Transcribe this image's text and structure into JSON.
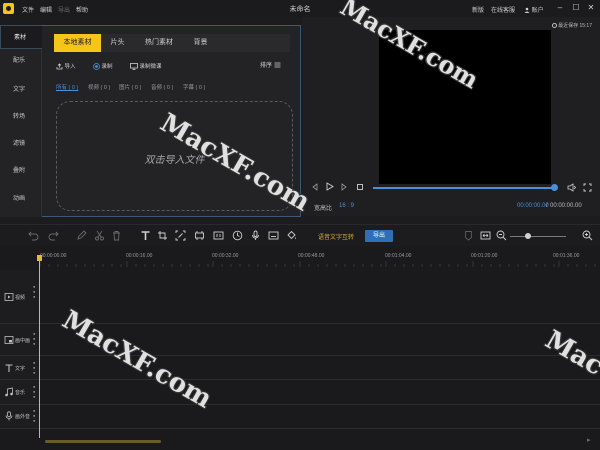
{
  "titlebar": {
    "menus": [
      "文件",
      "编辑",
      "导出",
      "帮助"
    ],
    "title": "未命名",
    "right_items": [
      "新版",
      "在线客服",
      "账户"
    ],
    "window_buttons": [
      "minimize-icon",
      "maximize-icon",
      "close-icon"
    ]
  },
  "left_tabs": [
    "素材",
    "配乐",
    "文字",
    "转场",
    "滤镜",
    "叠附",
    "动画"
  ],
  "media": {
    "tabs": [
      "本地素材",
      "片头",
      "热门素材",
      "背景"
    ],
    "import_label": "导入",
    "record_label": "录制",
    "screen_record_label": "录制微课",
    "sort_label": "排序",
    "filters": [
      "所有 ( 0 )",
      "视频 ( 0 )",
      "图片 ( 0 )",
      "音频 ( 0 )",
      "字幕 ( 0 )"
    ],
    "drop_text": "双击导入文件"
  },
  "preview": {
    "autosave": "最近保存 15:17",
    "ratio_label": "宽高比",
    "ratio_value": "16 : 9",
    "time_current": "00:00:00.00",
    "time_separator": "/",
    "time_total": "00:00:00.00",
    "progress": 1.0
  },
  "toolbar": {
    "speech_label": "语音文字互转",
    "export_label": "导出"
  },
  "timeline": {
    "ruler": [
      "00:00:00.00",
      "00:00:16.00",
      "00:00:32.00",
      "00:00:48.00",
      "00:01:04.00",
      "00:01:20.00",
      "00:01:36.00"
    ],
    "tracks": [
      "视频",
      "画中画",
      "文字",
      "音乐",
      "画外音"
    ]
  },
  "watermarks": [
    "MacXF.com",
    "MacXF.com",
    "MacXF.com",
    "Mac"
  ],
  "colors": {
    "accent_yellow": "#f5c518",
    "accent_blue": "#4a90d9",
    "export_blue": "#2f6fb8"
  }
}
